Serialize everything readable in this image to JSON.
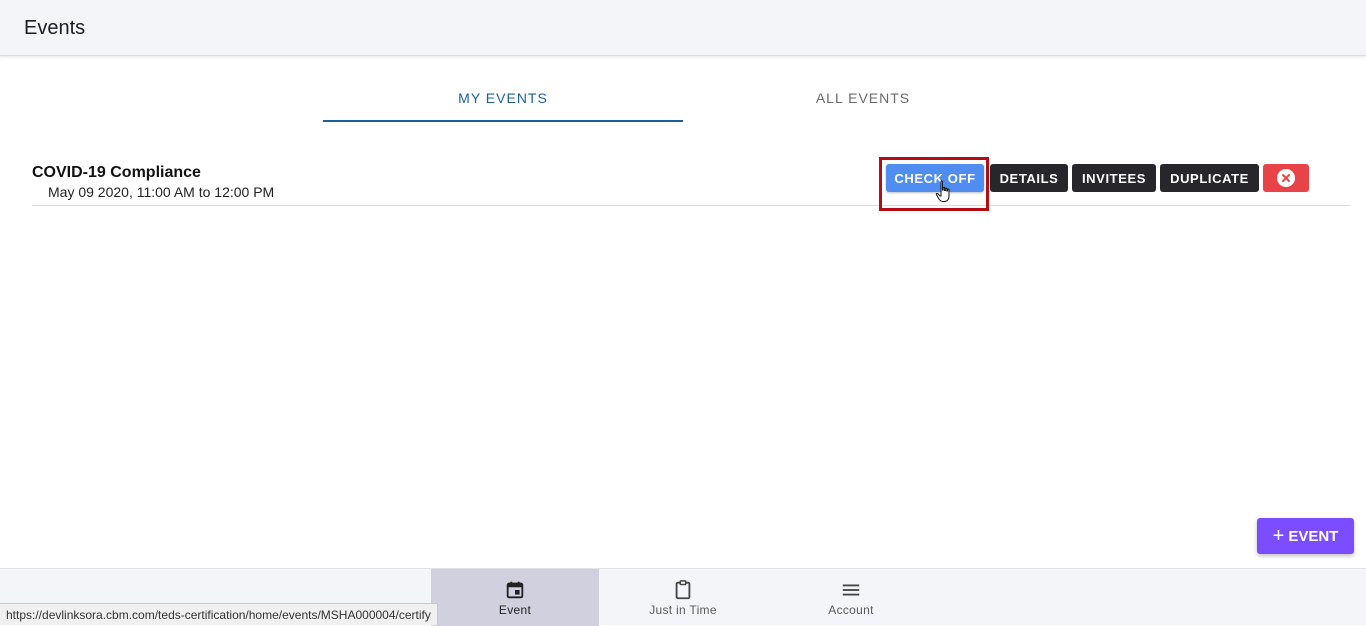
{
  "app_bar": {
    "title": "Events"
  },
  "tabs": [
    {
      "label": "MY EVENTS",
      "active": true
    },
    {
      "label": "ALL EVENTS",
      "active": false
    }
  ],
  "events": [
    {
      "title": "COVID-19 Compliance",
      "time": "May 09 2020, 11:00 AM to 12:00 PM",
      "actions": {
        "check_off": "CHECK OFF",
        "details": "DETAILS",
        "invitees": "INVITEES",
        "duplicate": "DUPLICATE",
        "delete_icon": "close-circle-icon"
      }
    }
  ],
  "fab": {
    "label": "EVENT",
    "icon": "plus-icon"
  },
  "bottom_nav": [
    {
      "label": "Event",
      "icon": "calendar-icon",
      "active": true
    },
    {
      "label": "Just in Time",
      "icon": "clipboard-icon",
      "active": false
    },
    {
      "label": "Account",
      "icon": "menu-icon",
      "active": false
    }
  ],
  "status_bar": {
    "url": "https://devlinksora.cbm.com/teds-certification/home/events/MSHA000004/certify"
  },
  "colors": {
    "primary_tab": "#1e5f99",
    "check_off": "#4f8ef0",
    "dark_button": "#26262b",
    "delete": "#e84346",
    "fab": "#7c4dff",
    "highlight": "#b10d12"
  }
}
